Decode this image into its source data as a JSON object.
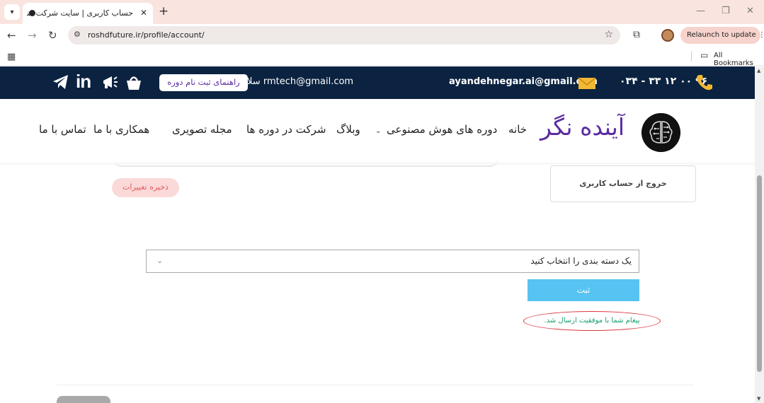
{
  "browser": {
    "tab_title": "حساب کاربری | سایت شرکت فناوری",
    "url": "roshdfuture.ir/profile/account/",
    "relaunch_label": "Relaunch to update",
    "bookmarks_label": "All Bookmarks"
  },
  "topbar": {
    "greeting": "سلام rmtech@gmail.com",
    "guide_button": "راهنمای ثبت نام دوره",
    "email": "ayandehnegar.ai@gmail.com",
    "phone": "۰۳۴ - ۳۳ ۱۲ ۰۰ ۹۶",
    "bg_color": "#0b2340",
    "icon_color": "#ffffff"
  },
  "nav": {
    "brand": "آینده نگر",
    "items": [
      "خانه",
      "دوره های هوش مصنوعی",
      "وبلاگ",
      "شرکت در دوره ها",
      "مجله تصویری",
      "همکاری با ما",
      "تماس با ما"
    ],
    "brand_color": "#5a2ca0"
  },
  "account": {
    "save_button": "ذخیره تغییرات",
    "logout": "خروج از حساب کاربری"
  },
  "form": {
    "category_placeholder": "یک دسته بندی را انتخاب کنید",
    "submit_label": "ثبت",
    "success_message": "پیغام شما با موفقیت ارسال شد.",
    "submit_color": "#56c3f2",
    "success_color": "#15a06a",
    "highlight_color": "#d9363e"
  }
}
